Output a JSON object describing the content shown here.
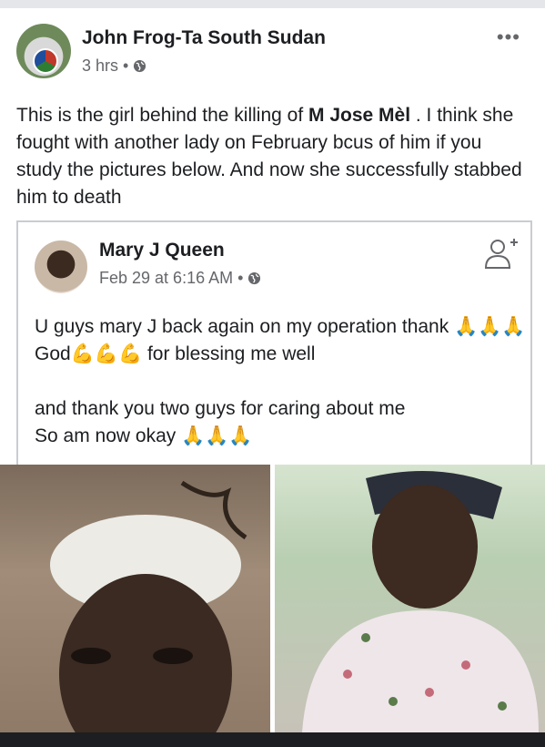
{
  "post": {
    "author": "John Frog-Ta South Sudan",
    "time": "3 hrs",
    "separator": "•",
    "more": "•••",
    "text_before": "This is the girl behind the killing of ",
    "text_bold": "M Jose Mèl",
    "text_after": " . I think she fought with another lady on February bcus of him if you study the pictures below. And now she successfully stabbed him to death"
  },
  "shared_post": {
    "author": "Mary J Queen",
    "time": "Feb 29 at 6:16 AM",
    "separator": "•",
    "text": "U guys mary J back again on my operation thank 🙏🙏🙏God💪💪💪  for blessing me well\n\nand thank you two guys for caring about me\nSo am now okay 🙏🙏🙏"
  },
  "icons": {
    "privacy": "globe-icon",
    "menu": "more-options-icon",
    "add_friend": "add-friend-icon"
  },
  "colors": {
    "text": "#1c1e21",
    "secondary": "#65676b",
    "border": "#c9ccd1"
  }
}
